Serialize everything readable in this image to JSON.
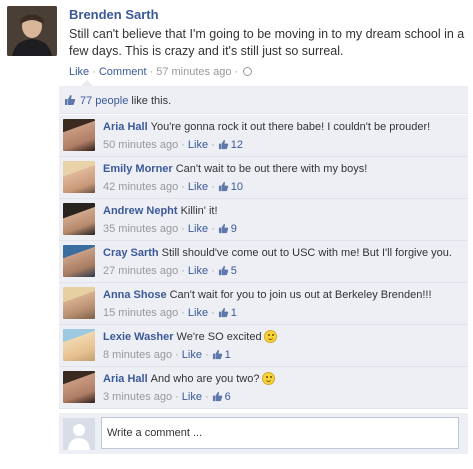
{
  "post": {
    "author": "Brenden Sarth",
    "message": "Still can't believe that I'm going to be moving in to my dream school in a few days. This is crazy and it's still just so surreal.",
    "actions": {
      "like": "Like",
      "comment": "Comment",
      "time": "57 minutes ago"
    }
  },
  "likes": {
    "people": "77 people",
    "suffix": " like this."
  },
  "comments": [
    {
      "name": "Aria Hall",
      "text": "You're gonna rock it out there babe! I couldn't be prouder!",
      "time": "50 minutes ago",
      "like": "Like",
      "count": "12",
      "smiley": false
    },
    {
      "name": "Emily Morner",
      "text": "Can't wait to be out there with my boys!",
      "time": "42 minutes ago",
      "like": "Like",
      "count": "10",
      "smiley": false
    },
    {
      "name": "Andrew Nepht",
      "text": "Killin' it!",
      "time": "35 minutes ago",
      "like": "Like",
      "count": "9",
      "smiley": false
    },
    {
      "name": "Cray Sarth",
      "text": "Still should've come out to USC with me! But I'll forgive you.",
      "time": "27 minutes ago",
      "like": "Like",
      "count": "5",
      "smiley": false
    },
    {
      "name": "Anna Shose",
      "text": "Can't wait for you to join us out at Berkeley Brenden!!!",
      "time": "15 minutes ago",
      "like": "Like",
      "count": "1",
      "smiley": false
    },
    {
      "name": "Lexie Washer",
      "text": "We're SO excited",
      "time": "8 minutes ago",
      "like": "Like",
      "count": "1",
      "smiley": true
    },
    {
      "name": "Aria Hall",
      "text": "And who are you two?",
      "time": "3 minutes ago",
      "like": "Like",
      "count": "6",
      "smiley": true
    }
  ],
  "composer": {
    "placeholder": "Write a comment ..."
  },
  "colors": {
    "link": "#3b5998",
    "ufi_bg": "#edeff4",
    "meta": "#999999"
  }
}
